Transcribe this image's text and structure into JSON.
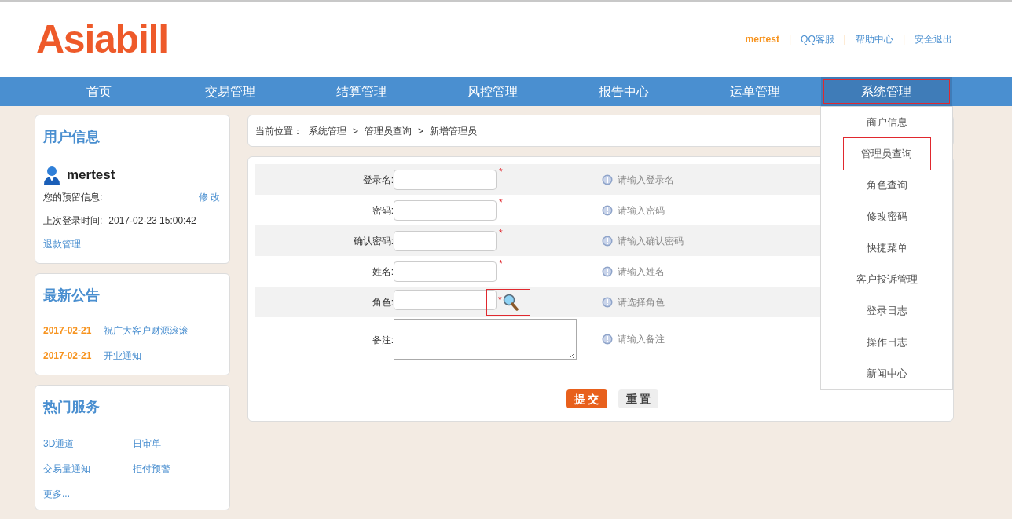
{
  "header": {
    "logo": "Asiabill",
    "user": "mertest",
    "links": [
      "QQ客服",
      "帮助中心",
      "安全退出"
    ],
    "separator": "|"
  },
  "nav": [
    {
      "label": "首页",
      "selected": false,
      "highlighted": false
    },
    {
      "label": "交易管理",
      "selected": false,
      "highlighted": false
    },
    {
      "label": "结算管理",
      "selected": false,
      "highlighted": false
    },
    {
      "label": "风控管理",
      "selected": false,
      "highlighted": false
    },
    {
      "label": "报告中心",
      "selected": false,
      "highlighted": false
    },
    {
      "label": "运单管理",
      "selected": false,
      "highlighted": false
    },
    {
      "label": "系统管理",
      "selected": true,
      "highlighted": true
    }
  ],
  "dropdown": [
    {
      "label": "商户信息",
      "highlighted": false
    },
    {
      "label": "管理员查询",
      "highlighted": true
    },
    {
      "label": "角色查询",
      "highlighted": false
    },
    {
      "label": "修改密码",
      "highlighted": false
    },
    {
      "label": "快捷菜单",
      "highlighted": false
    },
    {
      "label": "客户投诉管理",
      "highlighted": false
    },
    {
      "label": "登录日志",
      "highlighted": false
    },
    {
      "label": "操作日志",
      "highlighted": false
    },
    {
      "label": "新闻中心",
      "highlighted": false
    }
  ],
  "user_info": {
    "title": "用户信息",
    "name": "mertest",
    "reserved_label": "您的预留信息:",
    "edit": "修 改",
    "last_login_label": "上次登录时间:",
    "last_login": "2017-02-23 15:00:42",
    "link": "退款管理"
  },
  "notices": {
    "title": "最新公告",
    "items": [
      {
        "date": "2017-02-21",
        "text": "祝广大客户财源滚滚"
      },
      {
        "date": "2017-02-21",
        "text": "开业通知"
      }
    ]
  },
  "services": {
    "title": "热门服务",
    "items": [
      "3D通道",
      "日审单",
      "交易量通知",
      "拒付预警",
      "更多..."
    ]
  },
  "breadcrumb": {
    "label": "当前位置：",
    "path": [
      "系统管理",
      "管理员查询",
      "新增管理员"
    ],
    "separator": ">"
  },
  "form": {
    "fields": [
      {
        "kind": "input",
        "label": "登录名:",
        "required": true,
        "lookup": false,
        "hint": "请输入登录名"
      },
      {
        "kind": "input",
        "label": "密码:",
        "required": true,
        "lookup": false,
        "hint": "请输入密码"
      },
      {
        "kind": "input",
        "label": "确认密码:",
        "required": true,
        "lookup": false,
        "hint": "请输入确认密码"
      },
      {
        "kind": "input",
        "label": "姓名:",
        "required": true,
        "lookup": false,
        "hint": "请输入姓名"
      },
      {
        "kind": "input",
        "label": "角色:",
        "required": true,
        "lookup": true,
        "highlighted": true,
        "hint": "请选择角色"
      },
      {
        "kind": "textarea",
        "label": "备注:",
        "required": false,
        "lookup": false,
        "hint": "请输入备注"
      }
    ],
    "required_mark": "*",
    "submit": "提 交",
    "reset": "重 置"
  }
}
